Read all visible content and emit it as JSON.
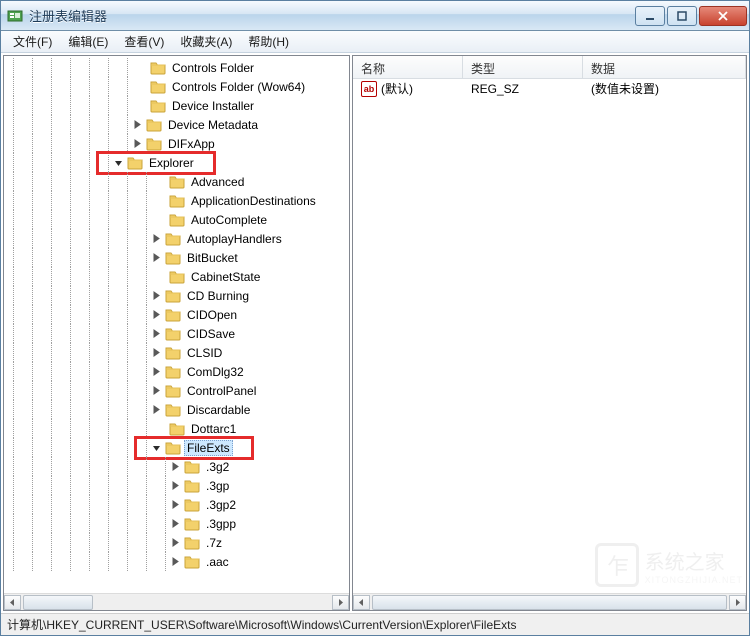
{
  "window": {
    "title": "注册表编辑器"
  },
  "menu": {
    "file": "文件(F)",
    "edit": "编辑(E)",
    "view": "查看(V)",
    "favorites": "收藏夹(A)",
    "help": "帮助(H)"
  },
  "tree": {
    "items": [
      {
        "depth": 7,
        "exp": "none",
        "label": "Controls Folder"
      },
      {
        "depth": 7,
        "exp": "none",
        "label": "Controls Folder (Wow64)"
      },
      {
        "depth": 7,
        "exp": "none",
        "label": "Device Installer"
      },
      {
        "depth": 7,
        "exp": "closed",
        "label": "Device Metadata"
      },
      {
        "depth": 7,
        "exp": "closed",
        "label": "DIFxApp"
      },
      {
        "depth": 6,
        "exp": "open",
        "label": "Explorer",
        "hl": true
      },
      {
        "depth": 8,
        "exp": "none",
        "label": "Advanced"
      },
      {
        "depth": 8,
        "exp": "none",
        "label": "ApplicationDestinations"
      },
      {
        "depth": 8,
        "exp": "none",
        "label": "AutoComplete"
      },
      {
        "depth": 8,
        "exp": "closed",
        "label": "AutoplayHandlers"
      },
      {
        "depth": 8,
        "exp": "closed",
        "label": "BitBucket"
      },
      {
        "depth": 8,
        "exp": "none",
        "label": "CabinetState"
      },
      {
        "depth": 8,
        "exp": "closed",
        "label": "CD Burning"
      },
      {
        "depth": 8,
        "exp": "closed",
        "label": "CIDOpen"
      },
      {
        "depth": 8,
        "exp": "closed",
        "label": "CIDSave"
      },
      {
        "depth": 8,
        "exp": "closed",
        "label": "CLSID"
      },
      {
        "depth": 8,
        "exp": "closed",
        "label": "ComDlg32"
      },
      {
        "depth": 8,
        "exp": "closed",
        "label": "ControlPanel"
      },
      {
        "depth": 8,
        "exp": "closed",
        "label": "Discardable"
      },
      {
        "depth": 8,
        "exp": "none",
        "label": "Dottarc1"
      },
      {
        "depth": 8,
        "exp": "open",
        "label": "FileExts",
        "hl": true,
        "selected": true
      },
      {
        "depth": 9,
        "exp": "closed",
        "label": ".3g2"
      },
      {
        "depth": 9,
        "exp": "closed",
        "label": ".3gp"
      },
      {
        "depth": 9,
        "exp": "closed",
        "label": ".3gp2"
      },
      {
        "depth": 9,
        "exp": "closed",
        "label": ".3gpp"
      },
      {
        "depth": 9,
        "exp": "closed",
        "label": ".7z"
      },
      {
        "depth": 9,
        "exp": "closed",
        "label": ".aac"
      }
    ]
  },
  "list": {
    "columns": {
      "name": "名称",
      "type": "类型",
      "data": "数据"
    },
    "rows": [
      {
        "icon": "ab",
        "name": "(默认)",
        "type": "REG_SZ",
        "data": "(数值未设置)"
      }
    ]
  },
  "statusbar": {
    "path": "计算机\\HKEY_CURRENT_USER\\Software\\Microsoft\\Windows\\CurrentVersion\\Explorer\\FileExts"
  },
  "watermark": {
    "text": "系统之家",
    "sub": "XITONGZHIJIA.NET"
  }
}
